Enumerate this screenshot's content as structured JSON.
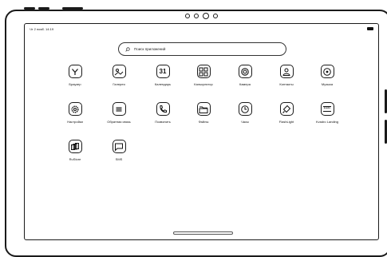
{
  "status_bar": {
    "time": "Чт 2 нояб. 14:19"
  },
  "search": {
    "placeholder": "Поиск приложений"
  },
  "apps": [
    {
      "label": "Браузер",
      "icon": "browser-icon"
    },
    {
      "label": "Галерея",
      "icon": "gallery-icon"
    },
    {
      "label": "Календарь",
      "icon": "calendar-icon",
      "icon_text": "31"
    },
    {
      "label": "Калькулятор",
      "icon": "calculator-icon"
    },
    {
      "label": "Камера",
      "icon": "camera-icon"
    },
    {
      "label": "Контакты",
      "icon": "contacts-icon"
    },
    {
      "label": "Музыка",
      "icon": "music-icon"
    },
    {
      "label": "Настройки",
      "icon": "settings-icon"
    },
    {
      "label": "Обратная связь",
      "icon": "feedback-icon"
    },
    {
      "label": "Позвонить",
      "icon": "phone-icon"
    },
    {
      "label": "Файлы",
      "icon": "files-icon"
    },
    {
      "label": "Часы",
      "icon": "clock-icon"
    },
    {
      "label": "FlashLight",
      "icon": "flashlight-icon"
    },
    {
      "label": "Kvadro Landing",
      "icon": "kvadro-landing-icon",
      "icon_text": "kvadro"
    },
    {
      "label": "RuStore",
      "icon": "rustore-icon"
    },
    {
      "label": "SMS",
      "icon": "sms-icon"
    }
  ]
}
